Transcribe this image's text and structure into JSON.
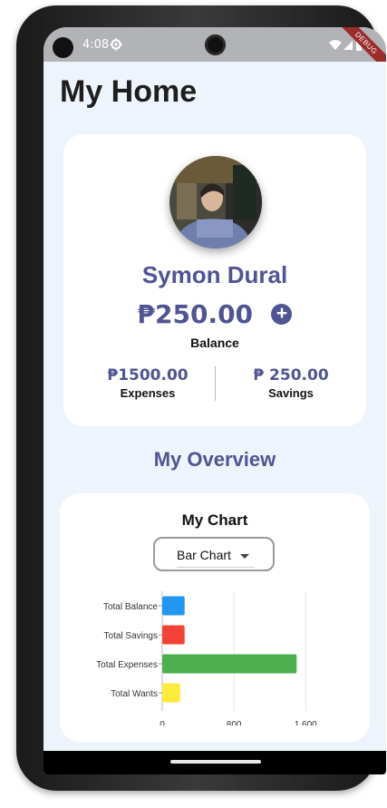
{
  "status_bar": {
    "time": "4:08",
    "debug_banner": "DEBUG"
  },
  "page": {
    "title": "My Home"
  },
  "profile": {
    "name": "Symon Dural",
    "balance": "₱250.00",
    "balance_label": "Balance",
    "expenses_amount": "₱1500.00",
    "expenses_label": "Expenses",
    "savings_amount": "₱ 250.00",
    "savings_label": "Savings"
  },
  "overview": {
    "title": "My Overview",
    "chart_title": "My Chart",
    "chart_type_selected": "Bar Chart"
  },
  "colors": {
    "accent": "#4f5492",
    "background": "#eef4fb",
    "bar_blue": "#2196f3",
    "bar_red": "#f44336",
    "bar_green": "#4caf50",
    "bar_yellow": "#ffeb3b"
  },
  "chart_data": {
    "type": "bar",
    "orientation": "horizontal",
    "categories": [
      "Total Balance",
      "Total Savings",
      "Total Expenses",
      "Total Wants"
    ],
    "values": [
      250,
      250,
      1500,
      200
    ],
    "colors": [
      "#2196f3",
      "#f44336",
      "#4caf50",
      "#ffeb3b"
    ],
    "xlim": [
      0,
      1800
    ],
    "xticks": [
      0,
      800,
      1600
    ],
    "xtick_labels": [
      "0",
      "800",
      "1,600"
    ],
    "grid": "vertical"
  }
}
